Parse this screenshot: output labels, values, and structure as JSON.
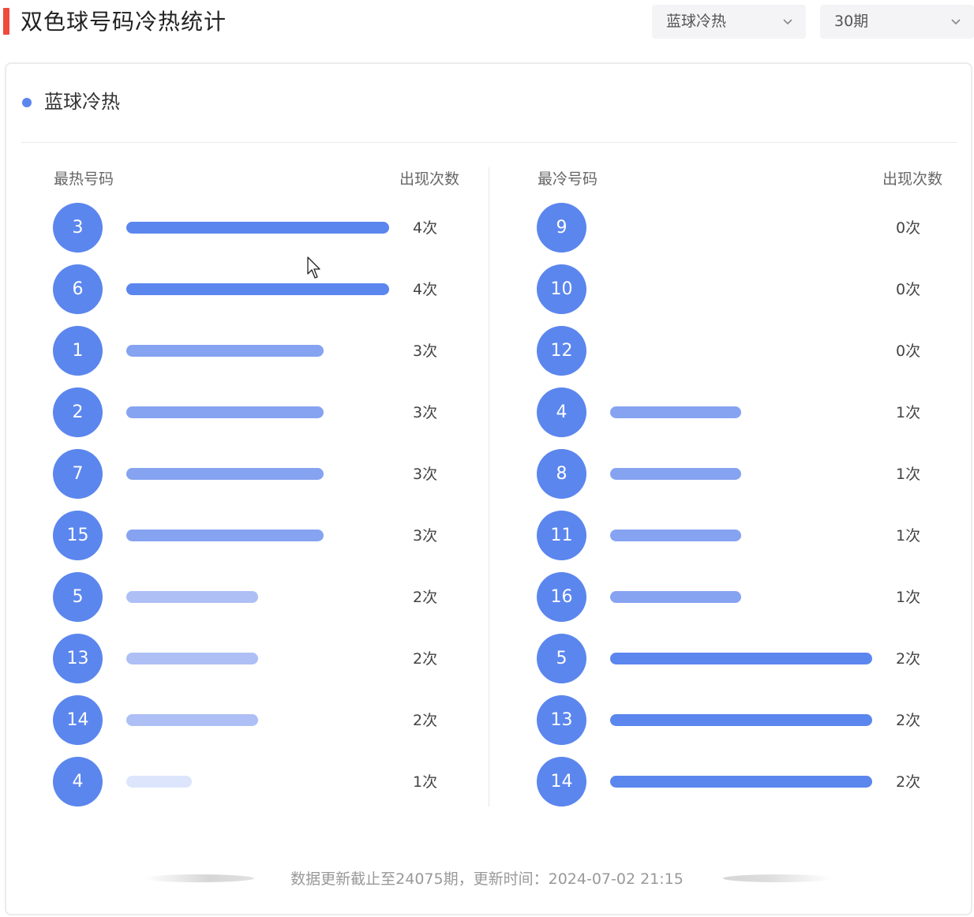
{
  "header": {
    "title": "双色球号码冷热统计",
    "type_select": "蓝球冷热",
    "period_select": "30期"
  },
  "section": {
    "title": "蓝球冷热"
  },
  "hot": {
    "header_label": "最热号码",
    "count_label": "出现次数",
    "rows": [
      {
        "num": "3",
        "count": "4次",
        "value": 4
      },
      {
        "num": "6",
        "count": "4次",
        "value": 4
      },
      {
        "num": "1",
        "count": "3次",
        "value": 3
      },
      {
        "num": "2",
        "count": "3次",
        "value": 3
      },
      {
        "num": "7",
        "count": "3次",
        "value": 3
      },
      {
        "num": "15",
        "count": "3次",
        "value": 3
      },
      {
        "num": "5",
        "count": "2次",
        "value": 2
      },
      {
        "num": "13",
        "count": "2次",
        "value": 2
      },
      {
        "num": "14",
        "count": "2次",
        "value": 2
      },
      {
        "num": "4",
        "count": "1次",
        "value": 1
      }
    ]
  },
  "cold": {
    "header_label": "最冷号码",
    "count_label": "出现次数",
    "rows": [
      {
        "num": "9",
        "count": "0次",
        "value": 0
      },
      {
        "num": "10",
        "count": "0次",
        "value": 0
      },
      {
        "num": "12",
        "count": "0次",
        "value": 0
      },
      {
        "num": "4",
        "count": "1次",
        "value": 1
      },
      {
        "num": "8",
        "count": "1次",
        "value": 1
      },
      {
        "num": "11",
        "count": "1次",
        "value": 1
      },
      {
        "num": "16",
        "count": "1次",
        "value": 1
      },
      {
        "num": "5",
        "count": "2次",
        "value": 2
      },
      {
        "num": "13",
        "count": "2次",
        "value": 2
      },
      {
        "num": "14",
        "count": "2次",
        "value": 2
      }
    ]
  },
  "footer": {
    "text": "数据更新截止至24075期，更新时间：2024-07-02 21:15"
  },
  "colors": {
    "accent": "#f04a3d",
    "ball": "#5b86ee",
    "bar_levels": [
      "#dce5fb",
      "#aebff5",
      "#86a3f1",
      "#5b86ee"
    ]
  }
}
